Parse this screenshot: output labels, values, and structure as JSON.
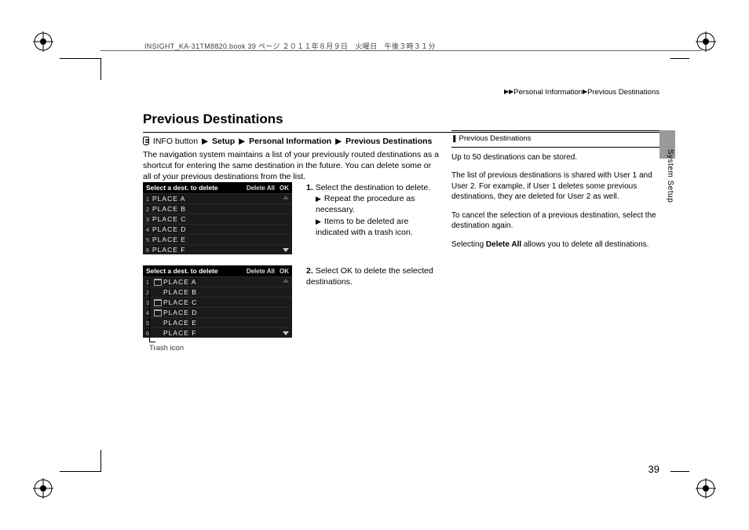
{
  "meta": {
    "header_meta": "INSIGHT_KA-31TM8820.book  39 ページ  ２０１１年８月９日　火曜日　午後３時３１分"
  },
  "breadcrumb": {
    "sep": "▶▶",
    "a": "Personal Information",
    "sep2": "▶",
    "b": "Previous Destinations"
  },
  "title": "Previous Destinations",
  "nav_path": {
    "a": "INFO button",
    "b": "Setup",
    "c": "Personal Information",
    "d": "Previous Destinations"
  },
  "intro": "The navigation system maintains a list of your previously routed destinations as a shortcut for entering the same destination in the future. You can delete some or all of your previous destinations from the list.",
  "shot_header": {
    "title": "Select a dest. to delete",
    "delete_all": "Delete All",
    "ok": "OK"
  },
  "places": [
    {
      "n": "1",
      "name": "PLACE A"
    },
    {
      "n": "2",
      "name": "PLACE B"
    },
    {
      "n": "3",
      "name": "PLACE C"
    },
    {
      "n": "4",
      "name": "PLACE D"
    },
    {
      "n": "5",
      "name": "PLACE E"
    },
    {
      "n": "6",
      "name": "PLACE F"
    }
  ],
  "trash_caption": "Trash icon",
  "steps": {
    "s1": "1.",
    "s1_text": "Select the destination to delete.",
    "s1_a": "Repeat the procedure as necessary.",
    "s1_b": "Items to be deleted are indicated with a trash icon.",
    "s2": "2.",
    "s2_text_a": "Select ",
    "s2_ok": "OK",
    "s2_text_b": " to delete the selected destinations."
  },
  "sidebar": {
    "heading": "Previous Destinations",
    "p1": "Up to 50 destinations can be stored.",
    "p2": "The list of previous destinations is shared with User 1 and User 2. For example, if User 1 deletes some previous destinations, they are deleted for User 2 as well.",
    "p3": "To cancel the selection of a previous destination, select the destination again.",
    "p4a": "Selecting ",
    "p4b": "Delete All",
    "p4c": " allows you to delete all destinations."
  },
  "vert_label": "System Setup",
  "page_num": "39"
}
